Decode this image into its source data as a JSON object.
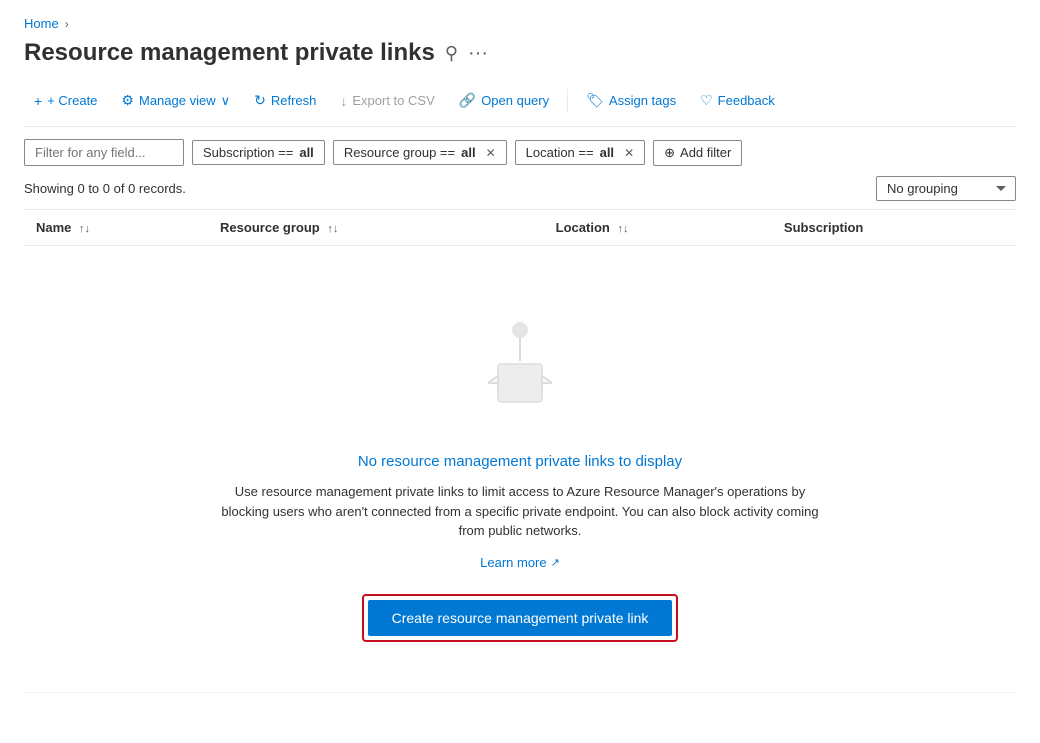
{
  "breadcrumb": {
    "home_label": "Home",
    "separator": "›"
  },
  "page": {
    "title": "Resource management private links",
    "pin_icon": "📌",
    "more_icon": "···"
  },
  "toolbar": {
    "create_label": "+ Create",
    "manage_view_label": "Manage view",
    "refresh_label": "Refresh",
    "export_csv_label": "Export to CSV",
    "open_query_label": "Open query",
    "assign_tags_label": "Assign tags",
    "feedback_label": "Feedback"
  },
  "filters": {
    "placeholder": "Filter for any field...",
    "subscription_label": "Subscription == ",
    "subscription_value": "all",
    "resource_group_label": "Resource group == ",
    "resource_group_value": "all",
    "location_label": "Location == ",
    "location_value": "all",
    "add_filter_label": "Add filter"
  },
  "results": {
    "text": "Showing 0 to 0 of 0 records.",
    "grouping_label": "No grouping"
  },
  "table": {
    "columns": [
      "Name",
      "Resource group",
      "Location",
      "Subscription"
    ]
  },
  "empty_state": {
    "title": "No resource management private links to display",
    "description": "Use resource management private links to limit access to Azure Resource Manager's operations by blocking users who aren't connected from a specific private endpoint. You can also block activity coming from public networks.",
    "learn_more_label": "Learn more",
    "external_icon": "↗",
    "create_btn_label": "Create resource management private link"
  }
}
